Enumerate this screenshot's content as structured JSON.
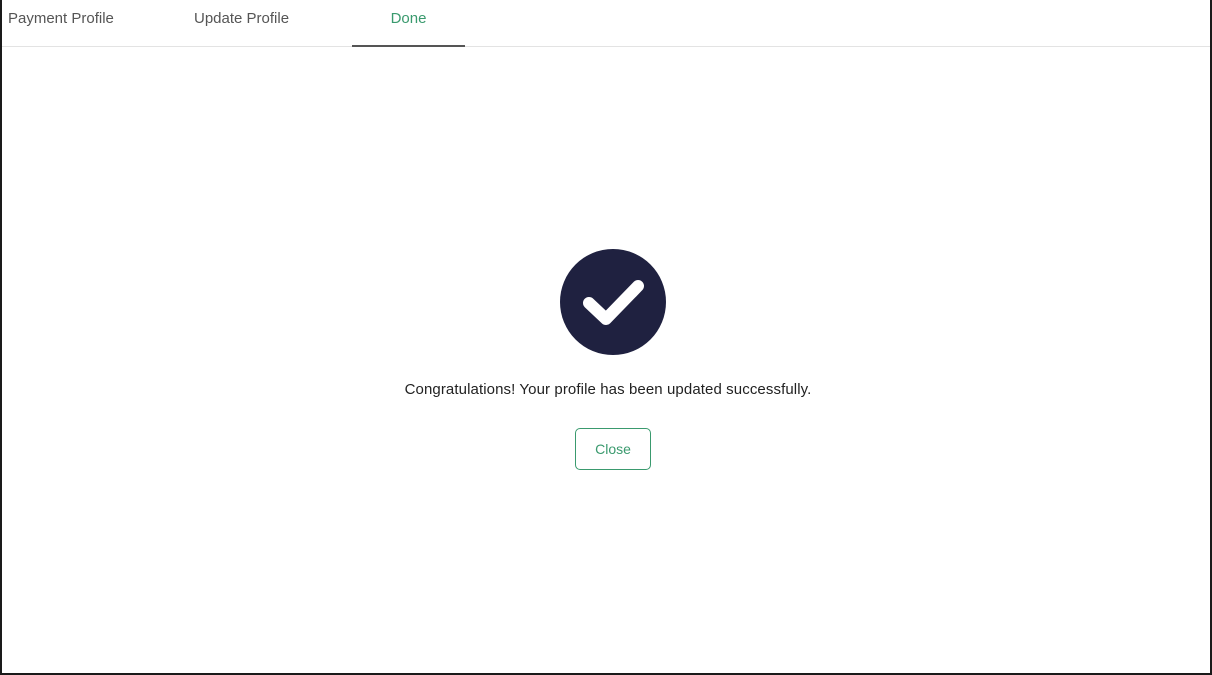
{
  "tabs": [
    {
      "label": "Payment Profile",
      "active": false
    },
    {
      "label": "Update Profile",
      "active": false
    },
    {
      "label": "Done",
      "active": true
    }
  ],
  "success": {
    "icon": "checkmark-circle-icon",
    "icon_color": "#1f2140",
    "message": "Congratulations! Your profile has been updated successfully."
  },
  "close_button": {
    "label": "Close",
    "color": "#3a9a6e"
  }
}
